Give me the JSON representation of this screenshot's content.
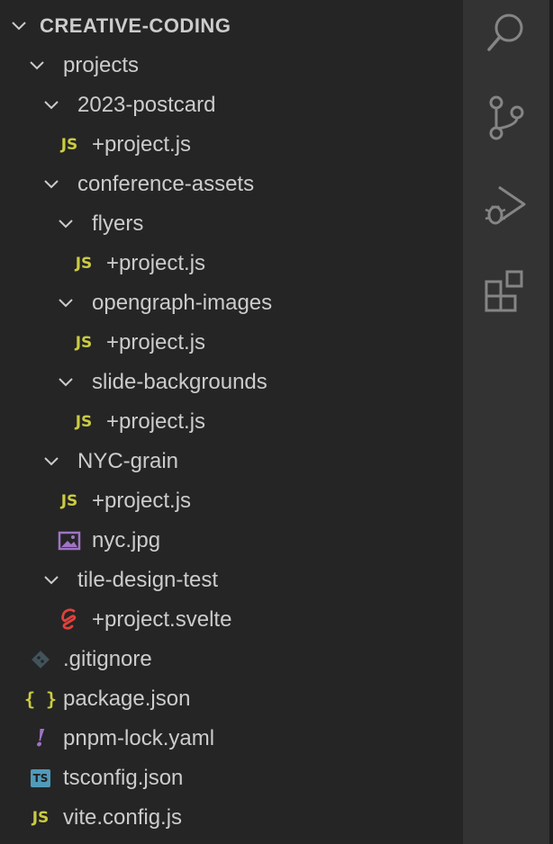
{
  "explorer": {
    "root_label": "CREATIVE-CODING",
    "items": [
      {
        "type": "folder",
        "depth": 1,
        "label": "projects"
      },
      {
        "type": "folder",
        "depth": 2,
        "label": "2023-postcard"
      },
      {
        "type": "js",
        "depth": 3,
        "label": "+project.js"
      },
      {
        "type": "folder",
        "depth": 2,
        "label": "conference-assets"
      },
      {
        "type": "folder",
        "depth": 3,
        "label": "flyers"
      },
      {
        "type": "js",
        "depth": 4,
        "label": "+project.js"
      },
      {
        "type": "folder",
        "depth": 3,
        "label": "opengraph-images"
      },
      {
        "type": "js",
        "depth": 4,
        "label": "+project.js"
      },
      {
        "type": "folder",
        "depth": 3,
        "label": "slide-backgrounds"
      },
      {
        "type": "js",
        "depth": 4,
        "label": "+project.js"
      },
      {
        "type": "folder",
        "depth": 2,
        "label": "NYC-grain"
      },
      {
        "type": "js",
        "depth": 3,
        "label": "+project.js"
      },
      {
        "type": "image",
        "depth": 3,
        "label": "nyc.jpg"
      },
      {
        "type": "folder",
        "depth": 2,
        "label": "tile-design-test"
      },
      {
        "type": "svelte",
        "depth": 3,
        "label": "+project.svelte"
      },
      {
        "type": "git",
        "depth": 1,
        "label": ".gitignore"
      },
      {
        "type": "json",
        "depth": 1,
        "label": "package.json"
      },
      {
        "type": "yaml",
        "depth": 1,
        "label": "pnpm-lock.yaml"
      },
      {
        "type": "ts",
        "depth": 1,
        "label": "tsconfig.json"
      },
      {
        "type": "js",
        "depth": 1,
        "label": "vite.config.js"
      }
    ]
  },
  "icons": {
    "js": "JS",
    "json": "{ }",
    "yaml": "!",
    "ts": "TS"
  },
  "activity_bar": [
    "search-icon",
    "source-control-icon",
    "run-debug-icon",
    "extensions-icon"
  ],
  "colors": {
    "sidebar_bg": "#252526",
    "activity_bg": "#333333",
    "text": "#cccccc",
    "js": "#cbcb41",
    "svelte": "#e2413a",
    "image": "#a074c4",
    "ts": "#519aba"
  }
}
